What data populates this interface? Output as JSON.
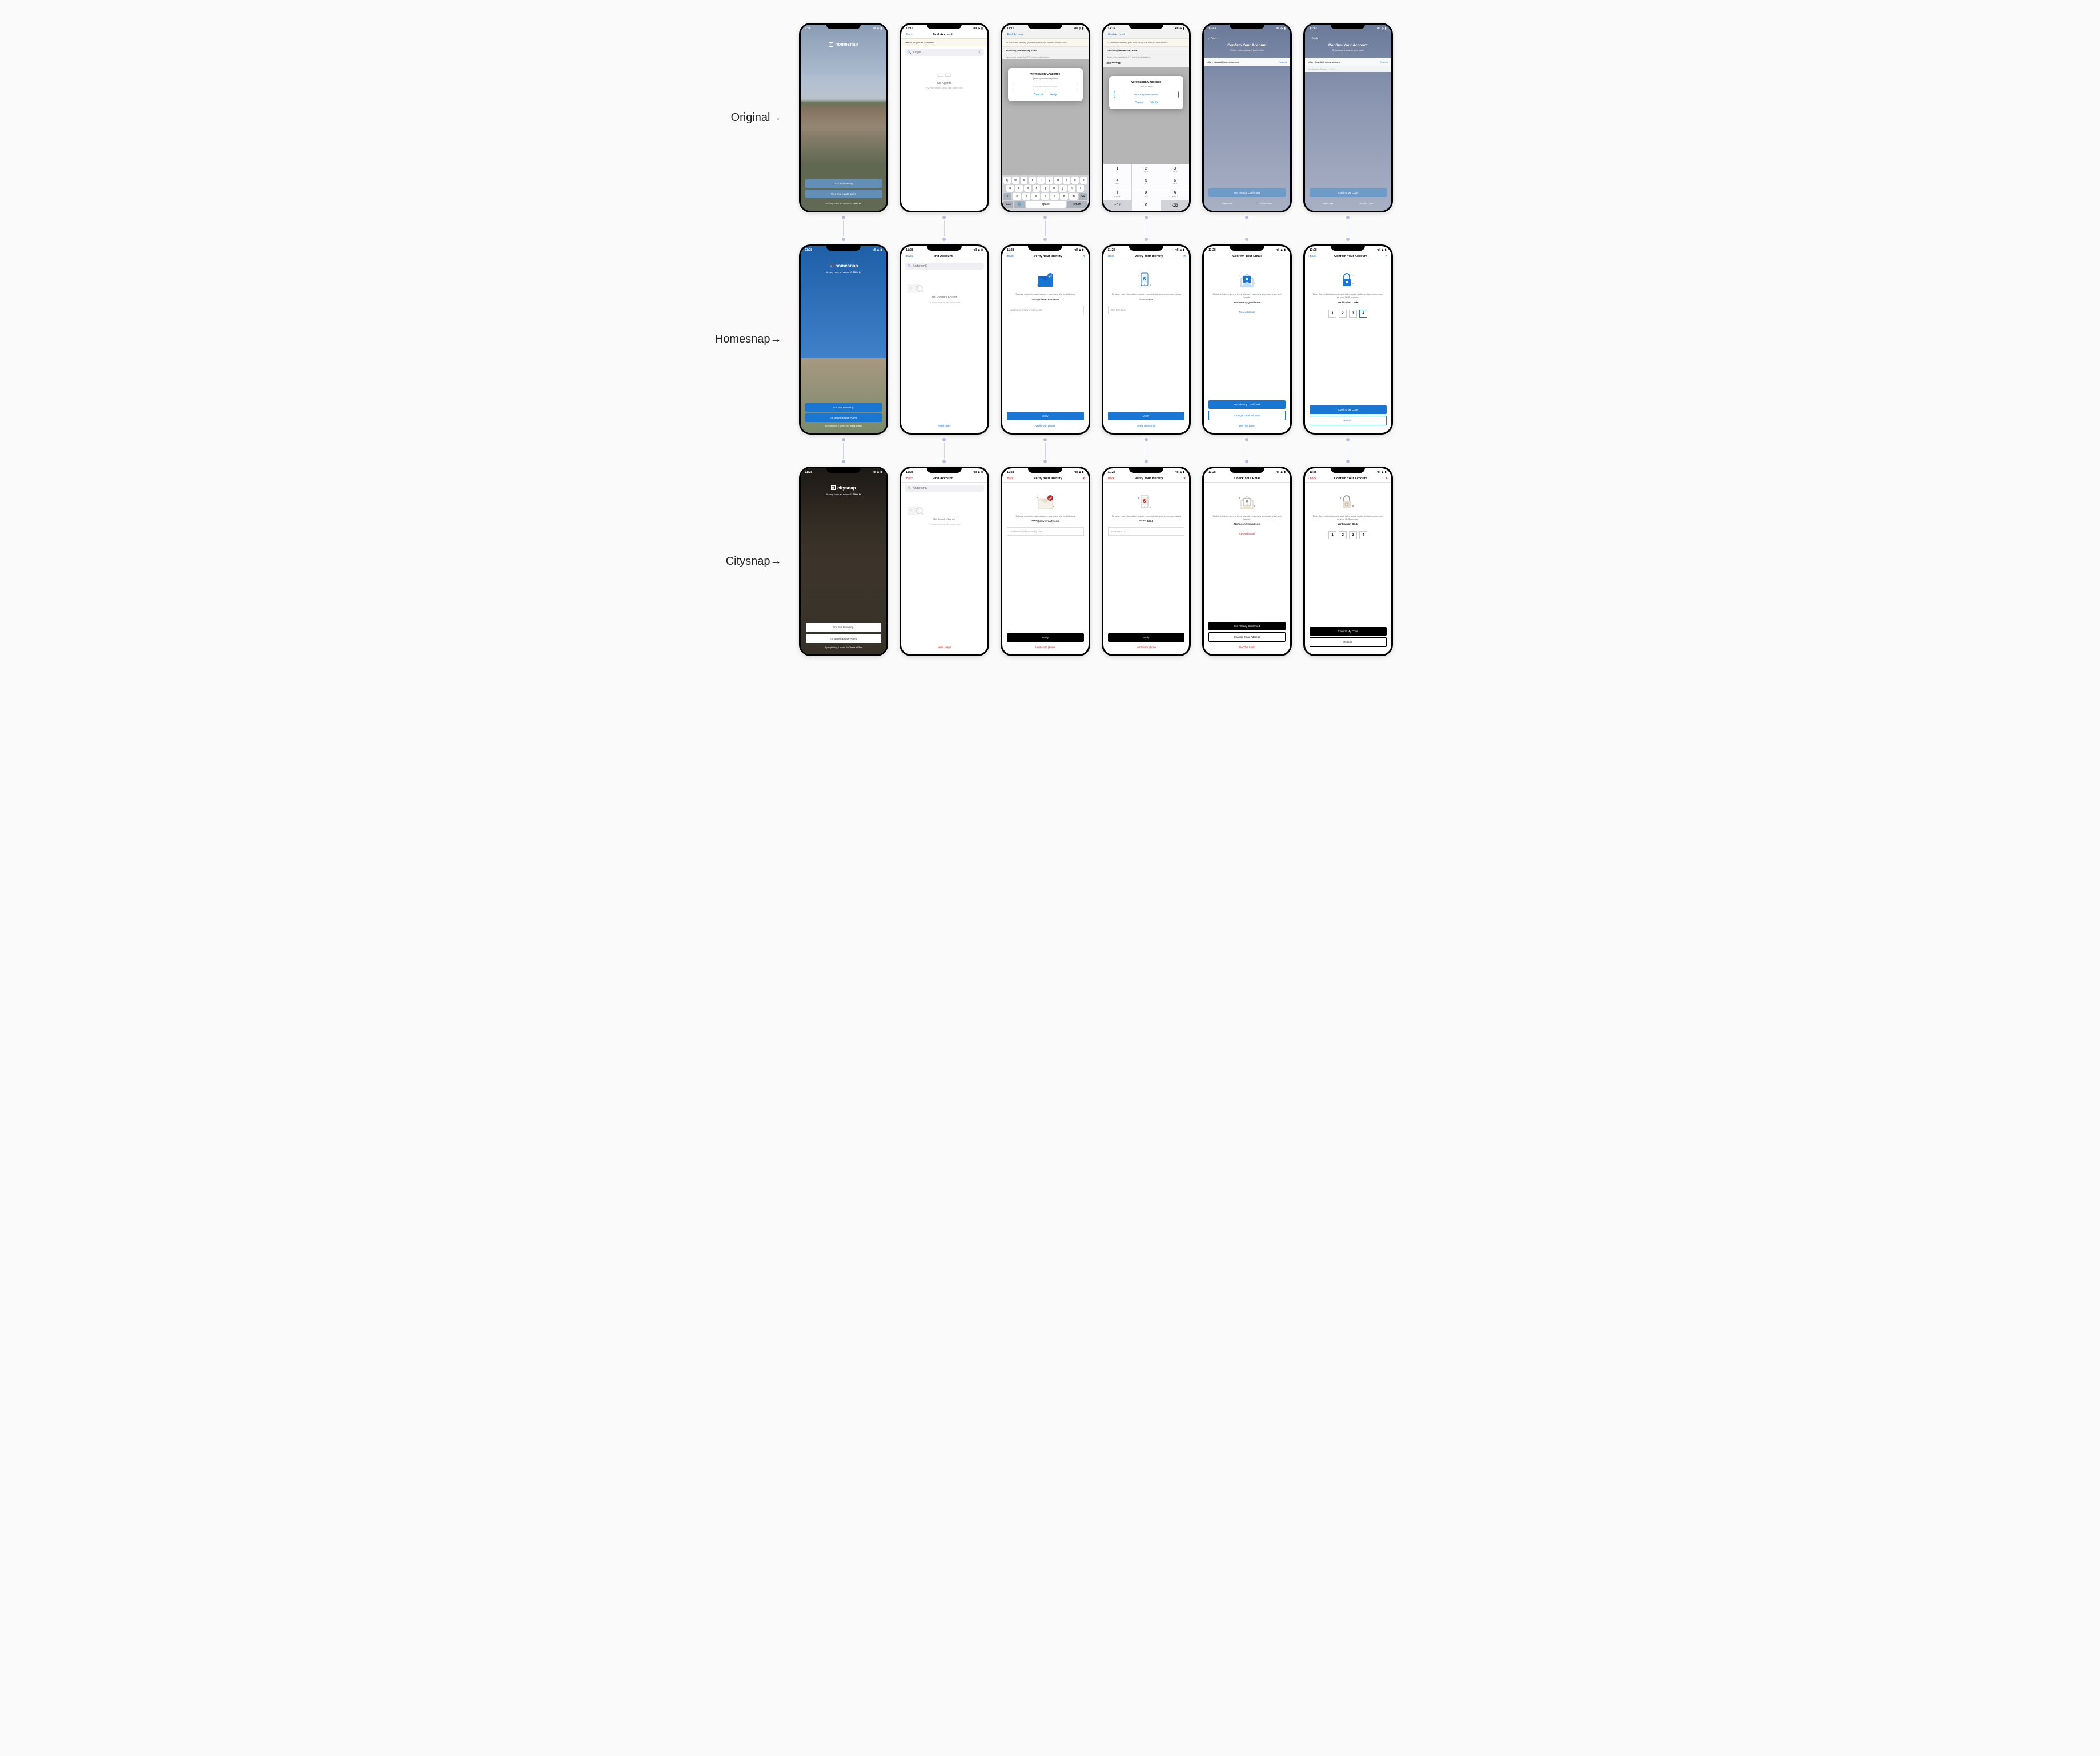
{
  "rows": {
    "original": "Original→",
    "homesnap": "Homesnap→",
    "citysnap": "Citysnap→"
  },
  "statusbar": {
    "t1": "1:58",
    "t2": "11:16",
    "t3": "13:15",
    "t4": "13:43",
    "t1128": "11:28",
    "t1308": "13:08",
    "arrow": "↗",
    "signal": "•ıll",
    "wifi": "⬙",
    "batt": "▮"
  },
  "logo": {
    "homesnap": "homesnap",
    "citysnap": "citysnap"
  },
  "landing": {
    "signin_q": "Already have an account?",
    "signin": "SIGN IN",
    "browse_orig": "I'm just browsing",
    "agent_orig": "I'm a real estate agent",
    "browse": "I'm Just Browsing",
    "agent": "I'm a Real Estate Agent",
    "terms_pre": "By registering, I accept the ",
    "terms": "Terms of Use"
  },
  "nav": {
    "back": "Back",
    "find": "Find Account",
    "verify": "Verify Your Identity",
    "confirm_email": "Confirm Your Email",
    "check_email": "Check Your Email",
    "confirm_acct": "Confirm Your Account",
    "close": "✕"
  },
  "search": {
    "label": "Search for your MLS identity",
    "orig_query": "Xinyus",
    "query": "AndersonS",
    "no_agents": "No Agents",
    "no_results": "No Results Found",
    "try_last": "Try your search using last name only",
    "try_last2": "Try searching by last name only",
    "need_help": "Need help?",
    "need_help2": "Need Help?"
  },
  "claim": {
    "banner": "To claim this identity, you must verify the contact information:",
    "email_masked_orig": "x********@homesnap.com",
    "tap_email": "Tap to send a validation PIN to this email address:",
    "phone_head": "202-***-**90",
    "dialog_title": "Verification Challenge",
    "email_sub": "y******@homesnap.com",
    "phone_sub": "202-***-**96",
    "email_ph": "Enter the email address",
    "phone_ph": "Enter full phone number",
    "cancel": "Cancel",
    "verify": "Verify"
  },
  "confirm": {
    "title": "Confirm Your Account",
    "sub_email": "Check your email and tap the link",
    "sub_code": "Check your email for your code",
    "email": "xifan+XinyuA@homesnap.com",
    "resend": "Resend",
    "code_label": "Verification Code",
    "code_ph": "ex: 1234",
    "confirmed": "I've Already Confirmed",
    "confirm_code": "Confirm My Code",
    "start_over": "Start Over",
    "later": "Do This Later"
  },
  "verify": {
    "keep_secure": "To keep your information secure, complete the email below",
    "keep_secure_phone": "To keep your information secure, complete the phone number below",
    "masked_email": "r*****@cleverrealty.com",
    "masked_phone": "***-***-1234",
    "input_email": "randerson@cleverrealty.com",
    "input_phone": "202-000-1234",
    "verify_btn": "Verify",
    "with_phone": "Verify with phone",
    "with_email": "Verify with email"
  },
  "email_confirm": {
    "body": "Click the link we sent to keep track of properties you snap, view and favorite.",
    "email": "JJohnson@gmail.com",
    "resend_email": "Resend Email",
    "confirmed": "I've Already Confirmed",
    "change": "Change Email Address",
    "later": "Do This Later"
  },
  "code_confirm": {
    "body_mls": "Enter the verification code sent to the email and/or cell phone number on your MLS account.",
    "body_rls": "Enter the verification code sent to the email and/or cell phone number on your RLS account.",
    "label": "Verification Code",
    "d1": "1",
    "d2": "2",
    "d3": "3",
    "d4": "4",
    "confirm": "Confirm My Code",
    "resend": "Resend"
  },
  "kb": {
    "r1": [
      "q",
      "w",
      "e",
      "r",
      "t",
      "y",
      "u",
      "i",
      "o",
      "p"
    ],
    "r2": [
      "a",
      "s",
      "d",
      "f",
      "g",
      "h",
      "j",
      "k",
      "l"
    ],
    "r3": [
      "⇧",
      "z",
      "x",
      "c",
      "v",
      "b",
      "n",
      "m",
      "⌫"
    ],
    "r4_123": "123",
    "r4_globe": "🌐",
    "r4_space": "space",
    "r4_return": "return"
  },
  "np": {
    "k1": {
      "n": "1",
      "s": ""
    },
    "k2": {
      "n": "2",
      "s": "ABC"
    },
    "k3": {
      "n": "3",
      "s": "DEF"
    },
    "k4": {
      "n": "4",
      "s": "GHI"
    },
    "k5": {
      "n": "5",
      "s": "JKL"
    },
    "k6": {
      "n": "6",
      "s": "MNO"
    },
    "k7": {
      "n": "7",
      "s": "PQRS"
    },
    "k8": {
      "n": "8",
      "s": "TUV"
    },
    "k9": {
      "n": "9",
      "s": "WXYZ"
    },
    "sym": "+ * #",
    "k0": "0",
    "del": "⌫"
  }
}
